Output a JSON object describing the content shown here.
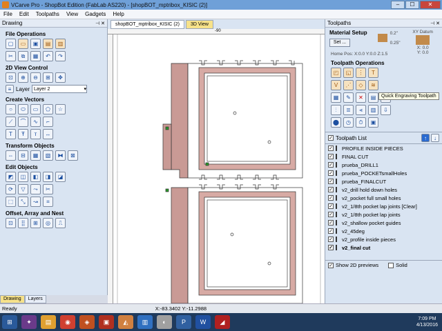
{
  "window": {
    "title": "VCarve Pro - ShopBot Edition (FabLab AS220) - [shopBOT_mptribox_KISIC (2)]",
    "btn_min": "–",
    "btn_max": "☐",
    "btn_close": "✕"
  },
  "menu": [
    "File",
    "Edit",
    "Toolpaths",
    "View",
    "Gadgets",
    "Help"
  ],
  "left_panel": {
    "header": "Drawing",
    "sections": {
      "file_ops": "File Operations",
      "view_control": "2D View Control",
      "layer_label": "Layer",
      "layer_value": "Layer 2",
      "create_vectors": "Create Vectors",
      "transform": "Transform Objects",
      "edit": "Edit Objects",
      "offset": "Offset, Array and Nest"
    },
    "tabs": [
      "Drawing",
      "Layers"
    ]
  },
  "document": {
    "tab_name": "shopBOT_mptribox_KISIC (2)",
    "tab_3d": "3D View",
    "ruler_label": "-90"
  },
  "right_panel": {
    "header": "Toolpaths",
    "material_setup": "Material Setup",
    "set_button": "Set ...",
    "thickness_top": "0.2\"",
    "thickness_bottom": "0.25\"",
    "home_pos": "Home Pos:  X:0.0 Y:0.0 Z:1.5",
    "xy_datum": "XY Datum",
    "x_val": "X: 0.0",
    "y_val": "Y: 0.0",
    "toolpath_ops": "Toolpath Operations",
    "tooltip": "Quick Engraving Toolpath",
    "toolpath_list_title": "Toolpath List",
    "toolpaths": [
      "PROFILE INSIDE PIECES",
      "FINAL CUT",
      "prueba_DRILL1",
      "prueba_POCKETsmallHoles",
      "prueba_FINALCUT",
      "v2_drill hold down holes",
      "v2_pocket full small holes",
      "v2_1/8th pocket lap joints [Clear]",
      "v2_1/8th pocket lap joints",
      "v2_shallow pocket guides",
      "v2_45deg",
      "v2_profile inside pieces",
      "v2_final cut"
    ],
    "show_2d": "Show 2D previews",
    "solid": "Solid"
  },
  "status": {
    "ready": "Ready",
    "coords": "X:-83.3402 Y:-11.2988"
  },
  "taskbar": {
    "time": "7:09 PM",
    "date": "4/13/2016"
  }
}
